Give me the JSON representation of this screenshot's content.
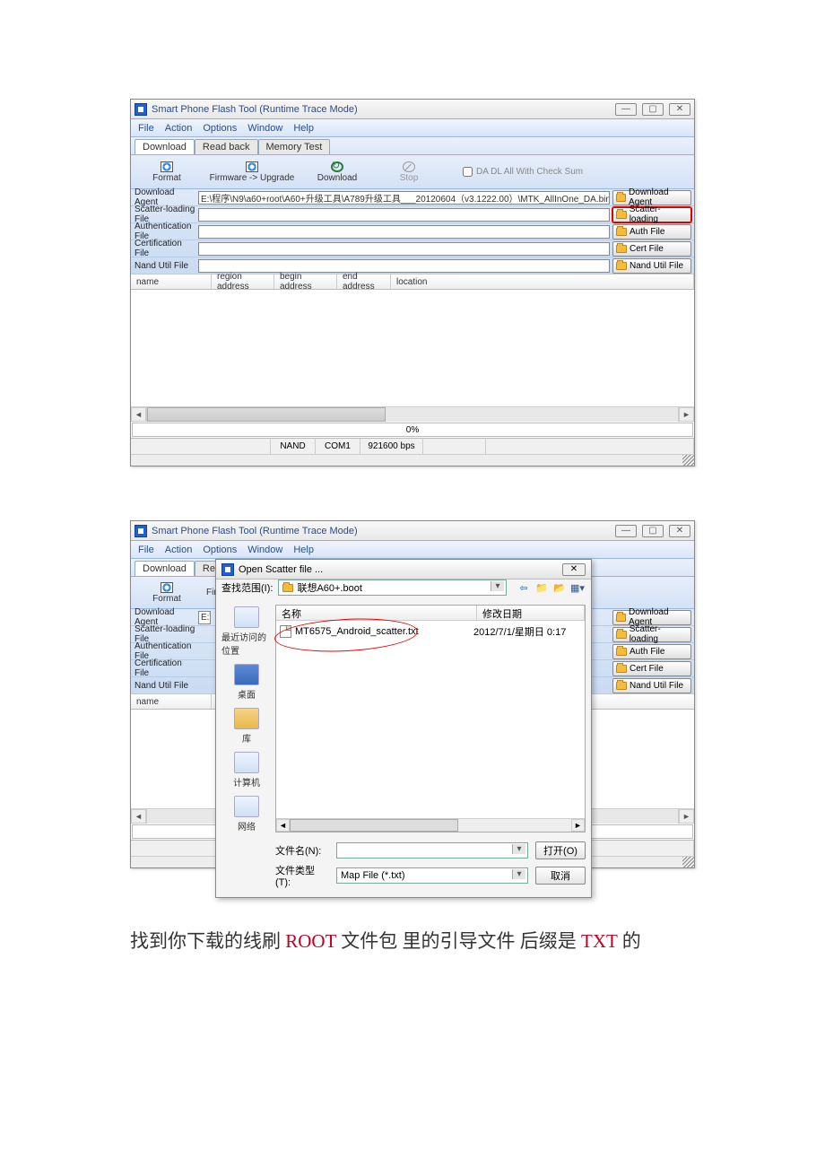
{
  "window_title": "Smart Phone Flash Tool (Runtime Trace Mode)",
  "menus": [
    "File",
    "Action",
    "Options",
    "Window",
    "Help"
  ],
  "tabs": [
    "Download",
    "Read back",
    "Memory Test"
  ],
  "toolbar": {
    "format": "Format",
    "upgrade": "Firmware -> Upgrade",
    "download": "Download",
    "stop": "Stop",
    "checksum": "DA DL All With Check Sum"
  },
  "filerows": {
    "download_agent_lbl": "Download Agent",
    "download_agent_val": "E:\\程序\\N9\\a60+root\\A60+升级工具\\A789升级工具___20120604（v3.1222.00）\\MTK_AllInOne_DA.bin",
    "scatter_lbl": "Scatter-loading File",
    "auth_lbl": "Authentication File",
    "cert_lbl": "Certification File",
    "nand_lbl": "Nand Util File",
    "btn_da": "Download Agent",
    "btn_scatter": "Scatter-loading",
    "btn_auth": "Auth File",
    "btn_cert": "Cert File",
    "btn_nand": "Nand Util File"
  },
  "table_headers": {
    "name": "name",
    "region": "region address",
    "begin": "begin address",
    "end": "end address",
    "location": "location"
  },
  "progress": "0%",
  "status": {
    "nand": "NAND",
    "com": "COM1",
    "bps": "921600 bps"
  },
  "dialog": {
    "title": "Open Scatter file ...",
    "look_in_lbl": "查找范围(I):",
    "look_in_val": "联想A60+.boot",
    "col_name": "名称",
    "col_date": "修改日期",
    "file": "MT6575_Android_scatter.txt",
    "file_date": "2012/7/1/星期日 0:17",
    "places": {
      "recent": "最近访问的位置",
      "desktop": "桌面",
      "lib": "库",
      "computer": "计算机",
      "network": "网络"
    },
    "filename_lbl": "文件名(N):",
    "filetype_lbl": "文件类型(T):",
    "filetype_val": "Map File (*.txt)",
    "open": "打开(O)",
    "cancel": "取消"
  },
  "caption": {
    "t1": "找到你下载的线刷 ",
    "t2": "ROOT",
    "t3": " 文件包  里的引导文件  后缀是 ",
    "t4": "TXT",
    "t5": " 的"
  }
}
